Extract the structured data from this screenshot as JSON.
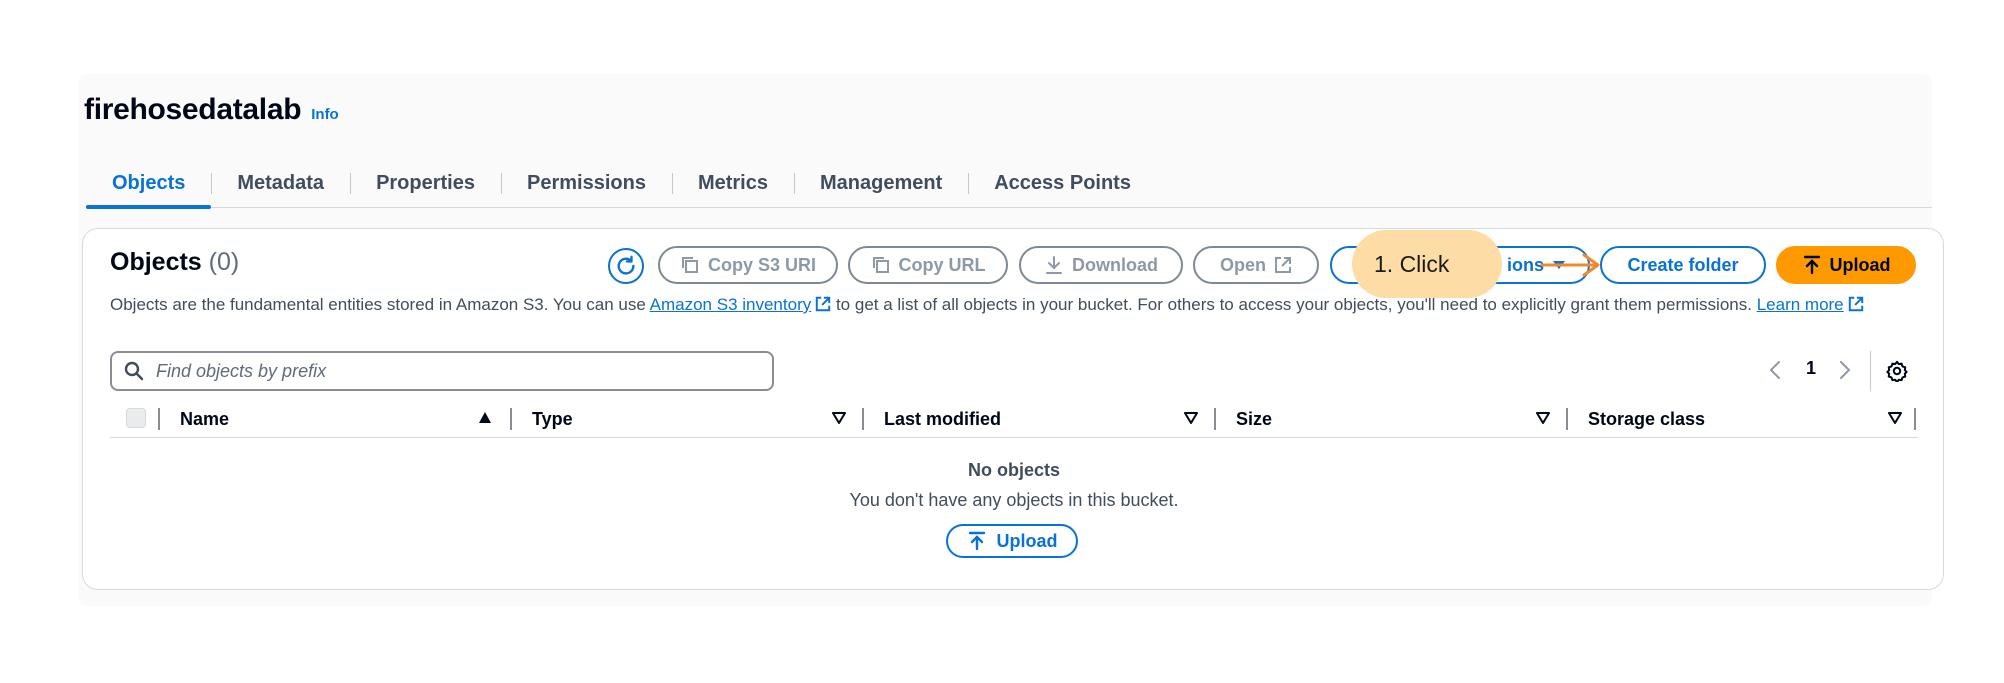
{
  "bucket": {
    "name": "firehosedatalab",
    "info_label": "Info"
  },
  "tabs": [
    {
      "label": "Objects"
    },
    {
      "label": "Metadata"
    },
    {
      "label": "Properties"
    },
    {
      "label": "Permissions"
    },
    {
      "label": "Metrics"
    },
    {
      "label": "Management"
    },
    {
      "label": "Access Points"
    }
  ],
  "objects_panel": {
    "title": "Objects",
    "count": "(0)",
    "description_before": "Objects are the fundamental entities stored in Amazon S3. You can use ",
    "inventory_link": "Amazon S3 inventory",
    "description_after": " to get a list of all objects in your bucket. For others to access your objects, you'll need to explicitly grant them permissions. ",
    "learn_more": "Learn more"
  },
  "toolbar": {
    "copy_s3_uri": "Copy S3 URI",
    "copy_url": "Copy URL",
    "download": "Download",
    "open": "Open",
    "actions_visible": "ions",
    "create_folder": "Create folder",
    "upload": "Upload"
  },
  "search": {
    "placeholder": "Find objects by prefix",
    "value": ""
  },
  "pagination": {
    "current_page": "1"
  },
  "table": {
    "columns": [
      "Name",
      "Type",
      "Last modified",
      "Size",
      "Storage class"
    ]
  },
  "empty_state": {
    "title": "No objects",
    "message": "You don't have any objects in this bucket.",
    "upload_label": "Upload"
  },
  "annotation": {
    "text": "1. Click"
  },
  "colors": {
    "link_blue": "#0972d3",
    "upload_orange": "#ff9900",
    "callout_fill": "#fddca5",
    "arrow_orange": "#f08a2c"
  }
}
